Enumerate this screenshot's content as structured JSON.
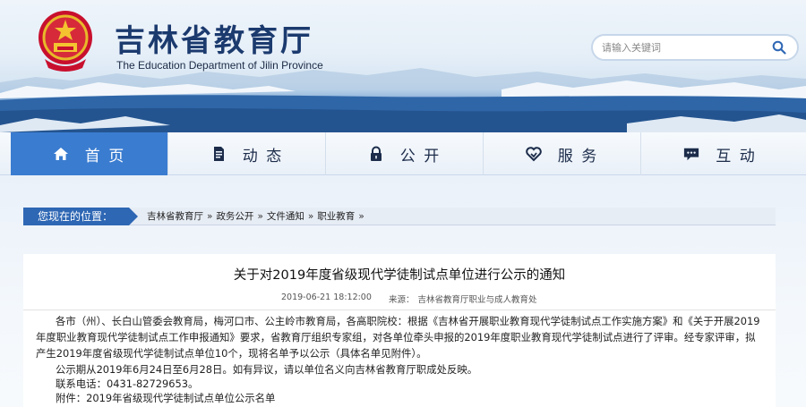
{
  "site": {
    "title": "吉林省教育厅",
    "subtitle": "The Education Department of Jilin Province"
  },
  "search": {
    "placeholder": "请输入关键词"
  },
  "nav": {
    "items": [
      {
        "label": "首 页",
        "icon": "home-icon",
        "active": true
      },
      {
        "label": "动 态",
        "icon": "document-icon",
        "active": false
      },
      {
        "label": "公 开",
        "icon": "lock-icon",
        "active": false
      },
      {
        "label": "服 务",
        "icon": "handshake-heart-icon",
        "active": false
      },
      {
        "label": "互 动",
        "icon": "chat-icon",
        "active": false
      }
    ]
  },
  "breadcrumb": {
    "label": "您现在的位置：",
    "items": [
      "吉林省教育厅",
      "政务公开",
      "文件通知",
      "职业教育"
    ],
    "separator": "»"
  },
  "article": {
    "title": "关于对2019年度省级现代学徒制试点单位进行公示的通知",
    "date": "2019-06-21 18:12:00",
    "source_label": "来源：",
    "source": "吉林省教育厅职业与成人教育处",
    "paragraphs": [
      "各市（州）、长白山管委会教育局，梅河口市、公主岭市教育局，各高职院校：根据《吉林省开展职业教育现代学徒制试点工作实施方案》和《关于开展2019年度职业教育现代学徒制试点工作申报通知》要求，省教育厅组织专家组，对各单位牵头申报的2019年度职业教育现代学徒制试点进行了评审。经专家评审，拟产生2019年度省级现代学徒制试点单位10个，现将名单予以公示（具体名单见附件）。",
      "公示期从2019年6月24日至6月28日。如有异议，请以单位名义向吉林省教育厅职成处反映。",
      "联系电话：0431-82729653。",
      "附件：2019年省级现代学徒制试点单位公示名单"
    ]
  },
  "colors": {
    "nav_active": "#3a7cd0",
    "breadcrumb_label": "#2e67b4",
    "title_text": "#1b3a6e"
  }
}
